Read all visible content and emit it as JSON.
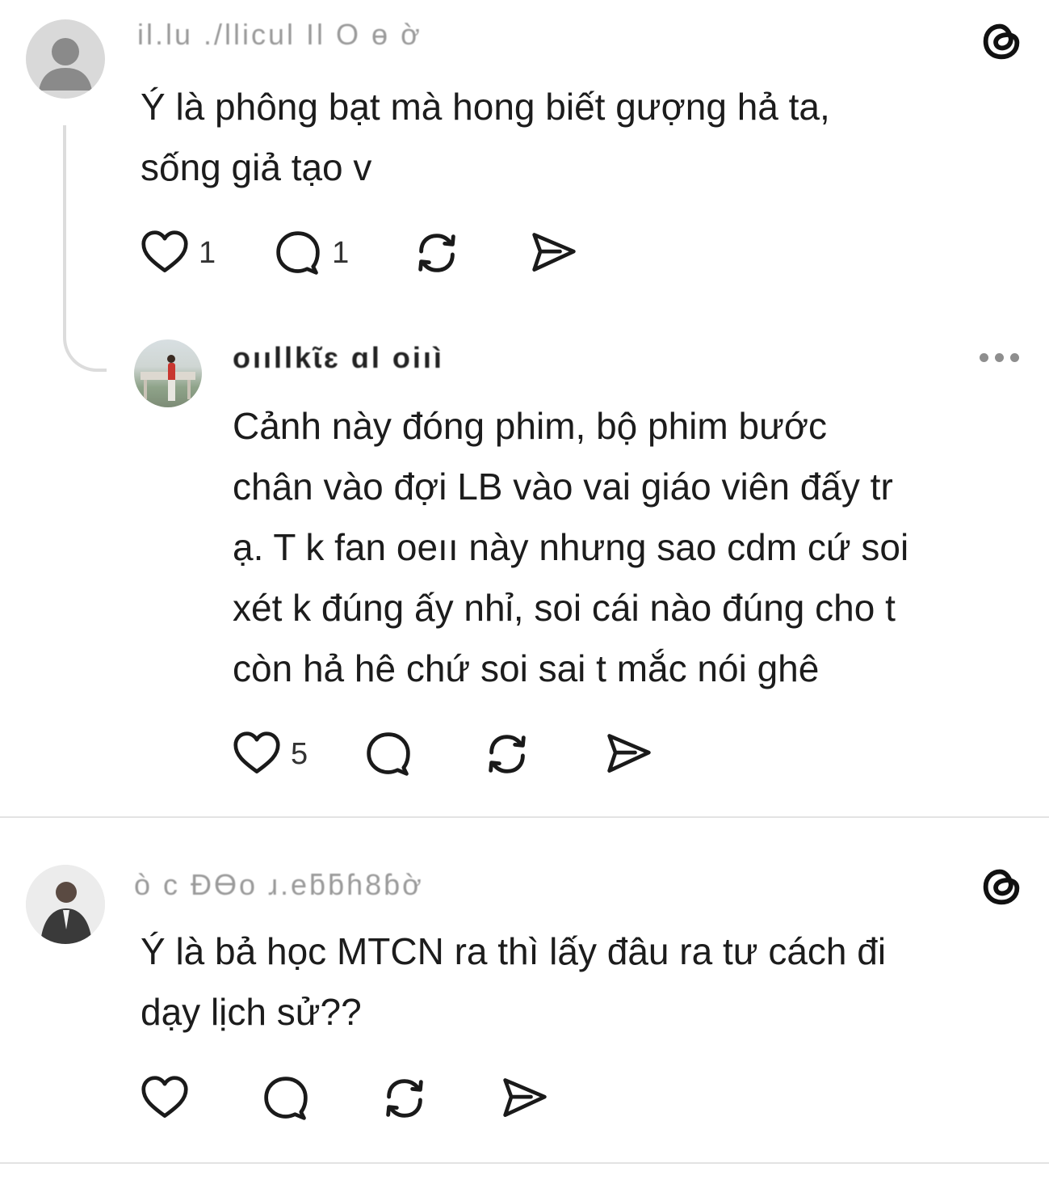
{
  "posts": [
    {
      "username": "il.lu  ./llicul  Il O ɵ ờ",
      "text": "Ý là phông bạt mà hong biết gượng hả ta,\nsống giả tạo v",
      "likes": "1",
      "replies": "1"
    },
    {
      "username": "oııllkɩ̃ɛ ɑl  oiıì",
      "text": "Cảnh này đóng phim, bộ phim bước\nchân vào đợi LB vào vai giáo viên đấy tr\nạ. T k fan oeıı này nhưng sao cdm cứ soi\nxét k đúng ấy nhỉ, soi cái nào đúng cho t\ncòn hả hê chứ soi sai t mắc nói ghê",
      "likes": "5",
      "replies": ""
    },
    {
      "username": "ò  c  ĐƟo  ɹ.eƃƃɦ8ɓờ",
      "text": "Ý là bả học MTCN ra thì lấy đâu ra tư cách đi\ndạy lịch sử??",
      "likes": "",
      "replies": ""
    }
  ],
  "icons": {
    "like": "heart-icon",
    "reply": "comment-icon",
    "repost": "repost-icon",
    "share": "send-icon",
    "app": "threads-icon",
    "more": "more-icon"
  },
  "colors": {
    "text": "#1c1c1c",
    "icon": "#1a1a1a",
    "divider": "#e3e3e3"
  }
}
